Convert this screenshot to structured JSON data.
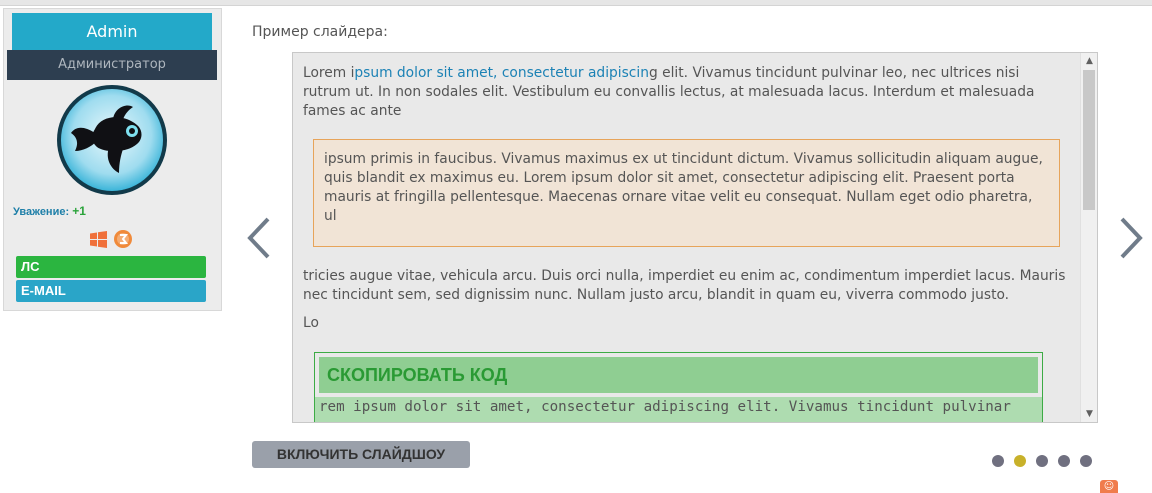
{
  "profile": {
    "username": "Admin",
    "role": "Администратор",
    "reputation_label": "Уважение:",
    "reputation_value": "+1",
    "btn_pm": "ЛС",
    "btn_email": "E-MAIL"
  },
  "slider": {
    "title": "Пример слайдера:",
    "p1_pre": "Lorem i",
    "p1_link": "psum dolor sit amet, consectetur adipiscin",
    "p1_post": "g elit. Vivamus tincidunt pulvinar leo, nec ultrices nisi rutrum ut. In non sodales elit. Vestibulum eu convallis lectus, at malesuada lacus. Interdum et malesuada fames ac ante",
    "quote": "ipsum primis in faucibus. Vivamus maximus ex ut tincidunt dictum. Vivamus sollicitudin aliquam augue, quis blandit ex maximus eu. Lorem ipsum dolor sit amet, consectetur adipiscing elit. Praesent porta mauris at fringilla pellentesque. Maecenas ornare vitae velit eu consequat. Nullam eget odio pharetra, ul",
    "p2": "tricies augue vitae, vehicula arcu. Duis orci nulla, imperdiet eu enim ac, condimentum imperdiet lacus. Mauris nec tincidunt sem, sed dignissim nunc. Nullam justo arcu, blandit in quam eu, viverra commodo justo.",
    "p3": "Lo",
    "code_header": "СКОПИРОВАТЬ КОД",
    "code_text": "rem ipsum dolor sit amet, consectetur adipiscing elit. Vivamus tincidunt pulvinar",
    "slideshow_button": "ВКЛЮЧИТЬ СЛАЙДШОУ",
    "dots_count": 5,
    "active_dot": 2
  },
  "colors": {
    "name_bar": "#23a9c9",
    "role_bar": "#2d3e50",
    "pm_button": "#2bb540",
    "email_button": "#2aa5c8",
    "active_dot": "#c8b12a"
  },
  "icons": [
    "windows-icon",
    "badge-icon",
    "arrow-left-icon",
    "arrow-right-icon"
  ]
}
